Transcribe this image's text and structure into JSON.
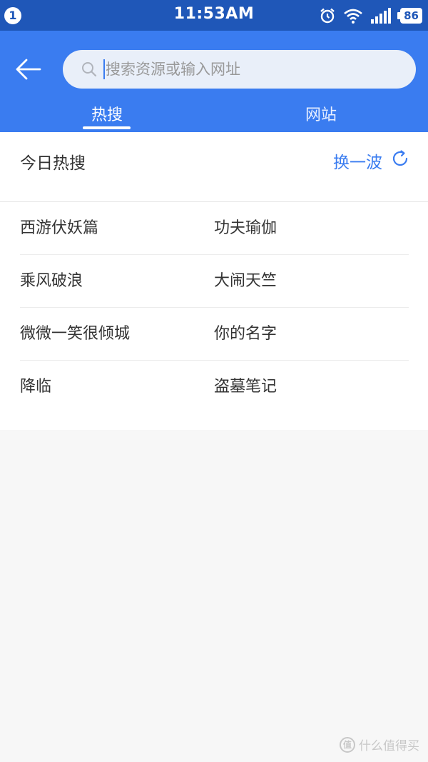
{
  "status_bar": {
    "notification_count": "1",
    "time": "11:53AM",
    "battery": "86",
    "icons": [
      "alarm-icon",
      "wifi-icon",
      "signal-icon"
    ]
  },
  "header": {
    "back_icon": "back-arrow-icon",
    "search": {
      "placeholder": "搜索资源或输入网址",
      "value": "",
      "icon": "search-icon"
    },
    "tabs": [
      {
        "label": "热搜",
        "active": true
      },
      {
        "label": "网站",
        "active": false
      }
    ]
  },
  "hot": {
    "title": "今日热搜",
    "refresh_label": "换一波",
    "refresh_icon": "refresh-icon",
    "rows": [
      {
        "left": "西游伏妖篇",
        "right": "功夫瑜伽"
      },
      {
        "left": "乘风破浪",
        "right": "大闹天竺"
      },
      {
        "left": "微微一笑很倾城",
        "right": "你的名字"
      },
      {
        "left": "降临",
        "right": "盗墓笔记"
      }
    ]
  },
  "watermark": {
    "logo": "值",
    "text": "什么值得买"
  },
  "colors": {
    "status_bar": "#1f57b8",
    "header": "#3a7cf0",
    "accent": "#3a7cf0",
    "background": "#f7f7f7"
  }
}
